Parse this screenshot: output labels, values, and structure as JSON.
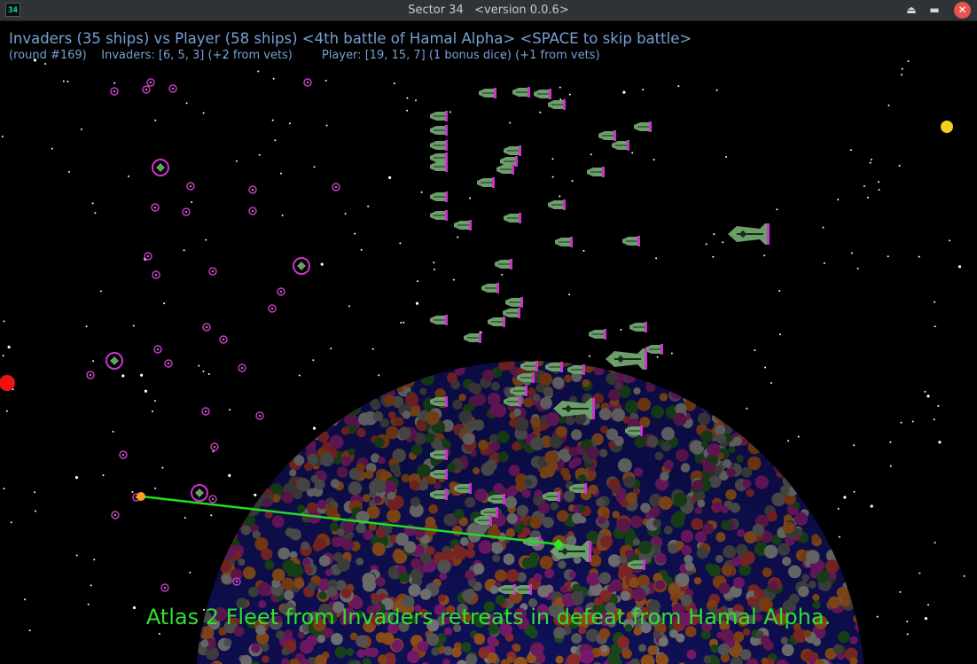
{
  "window": {
    "icon_label": "34",
    "title": "Sector 34   <version 0.0.6>",
    "buttons": {
      "shade": "⏏",
      "minimize": "▬",
      "close": "✕"
    }
  },
  "hud": {
    "line1": "Invaders (35 ships) vs Player (58 ships) <4th battle of Hamal Alpha> <SPACE to skip battle>",
    "round": "(round #169)",
    "invaders_stats": "Invaders: [6, 5, 3] (+2 from vets)",
    "player_stats": "Player: [19, 15, 7] (1 bonus dice) (+1 from vets)"
  },
  "message": "Atlas 2 Fleet from Invaders retreats in defeat from Hamal Alpha.",
  "colors": {
    "hud_text": "#77a0d2",
    "message": "#30e030",
    "invader_ship": "#cc33cc",
    "player_ship": "#6b9e6b",
    "player_fin": "#cc33cc",
    "laser": "#22dd22",
    "sun": "#f0d020",
    "red_planet": "#ee1111",
    "orange_marker": "#ffa020"
  },
  "icons": {
    "app": "sector34-app-icon",
    "shade": "eject-icon",
    "minimize": "minimize-icon",
    "close": "close-icon"
  }
}
